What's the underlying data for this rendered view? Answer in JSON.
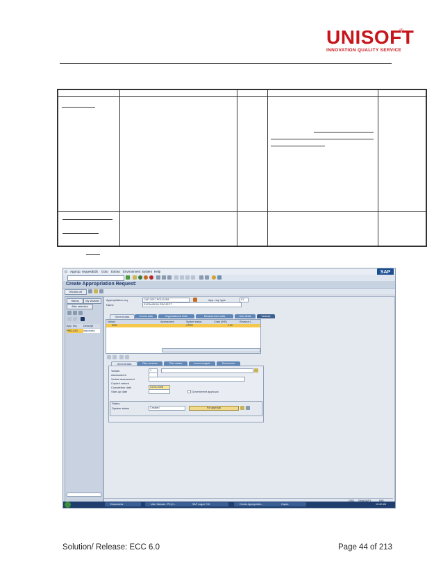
{
  "header": {
    "brand": "UNISOFT",
    "registered": "®",
    "tagline": "INNOVATION QUALITY SERVICE"
  },
  "sap": {
    "menu": [
      "Approp. request",
      "Edit",
      "Goto",
      "Extras",
      "Environment",
      "System",
      "Help"
    ],
    "logo": "SAP",
    "title": "Create Appropriation Request:",
    "worklist_label": "Worklist off",
    "nav": {
      "btn_history": "History",
      "btn_worklist": "My Worklist",
      "btn_selection": "Alter selection",
      "col_app_req": "App. req.",
      "col_descript": "Descript",
      "row_id": "PRD-015",
      "row_desc": "indo/hetto"
    },
    "form": {
      "approp_req_label": "Appropriation req.",
      "approp_req_value": "CAP-2007-P02-EXPA",
      "app_req_type_label": "App. req. type",
      "app_req_type_value": "01",
      "name_label": "Name",
      "name_value": "EXPANSION PROJECT"
    },
    "top_tabs": [
      "General data",
      "Control data",
      "Organizational Units",
      "Measurement units",
      "User fields",
      "Variants"
    ],
    "variant_grid": {
      "headers": [
        "Variant",
        "Assessment",
        "System status",
        "Costs (INR)",
        "Revenue i..."
      ],
      "row": {
        "variant": "0001",
        "status": "CRTD",
        "costs": "0.00"
      }
    },
    "bottom_tabs": [
      "General data",
      "Plan versions",
      "Plan values",
      "Invest analysis",
      "Documents"
    ],
    "variant_form": {
      "variant_label": "Variant",
      "variant_value": "1",
      "assessment_label": "Assessment",
      "verbal_label": "Verbal assessment",
      "copied_label": "Copied variant",
      "completion_label": "Completion date",
      "completion_value": "31.03.2008",
      "startup_label": "Start-up date",
      "gov_approval_label": "Government approval"
    },
    "status": {
      "section_label": "Status",
      "system_status_label": "System status",
      "system_status_value": "Created",
      "approval_button": "For approval"
    },
    "status_bar": {
      "session": "DS5",
      "system": "SHASAP1",
      "mode": "INS"
    },
    "taskbar": [
      "Documents",
      "User Manual - PS (C...",
      "SAP Logon 710",
      "Create Appropriatio...",
      "Capes"
    ],
    "clock": "10:42 AM"
  },
  "footer": {
    "left": "Solution/ Release: ECC 6.0",
    "right": "Page 44 of 213"
  }
}
